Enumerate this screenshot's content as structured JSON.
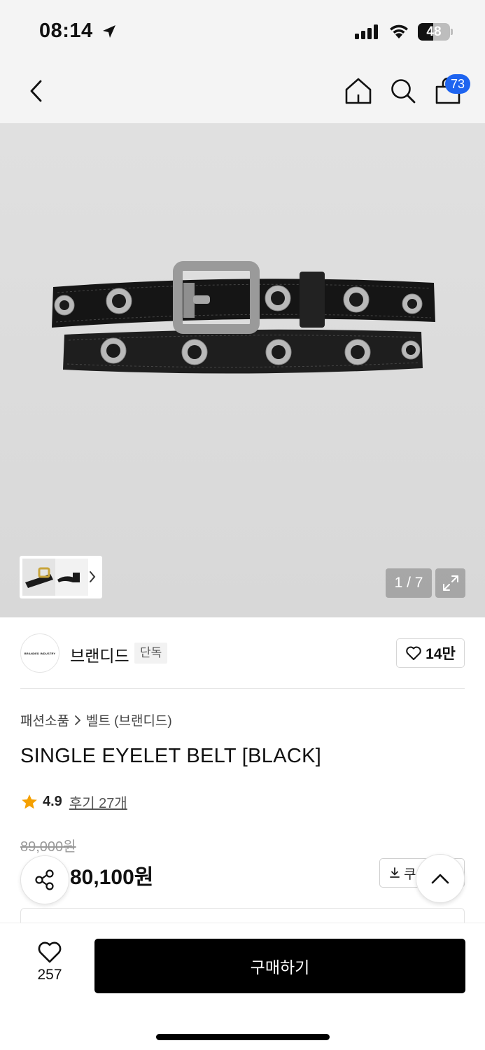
{
  "status_bar": {
    "time": "08:14",
    "battery": "48",
    "battery_level": 0.48
  },
  "header": {
    "cart_count": "73"
  },
  "gallery": {
    "counter": "1 / 7"
  },
  "brand": {
    "logo_text": "BRANDED INDUSTRY",
    "name": "브랜디드",
    "tag": "단독",
    "likes": "14만"
  },
  "product": {
    "breadcrumb": [
      "패션소품",
      "벨트 (브랜디드)"
    ],
    "title": "SINGLE EYELET BELT [BLACK]",
    "rating": "4.9",
    "reviews_label": "후기 27개",
    "original_price": "89,000원",
    "sale_price": "80,100원",
    "coupon_label": "쿠"
  },
  "bottom_bar": {
    "wish_count": "257",
    "buy_label": "구매하기"
  },
  "colors": {
    "accent_badge": "#1e64f0",
    "star": "#f5a000",
    "buy_button": "#000000"
  },
  "icons": [
    "location-arrow-icon",
    "signal-icon",
    "wifi-icon",
    "battery-icon",
    "back-chevron-icon",
    "home-icon",
    "search-icon",
    "cart-bag-icon",
    "chevron-right-icon",
    "expand-icon",
    "heart-outline-icon",
    "star-icon",
    "download-icon",
    "share-icon",
    "chevron-up-icon"
  ]
}
